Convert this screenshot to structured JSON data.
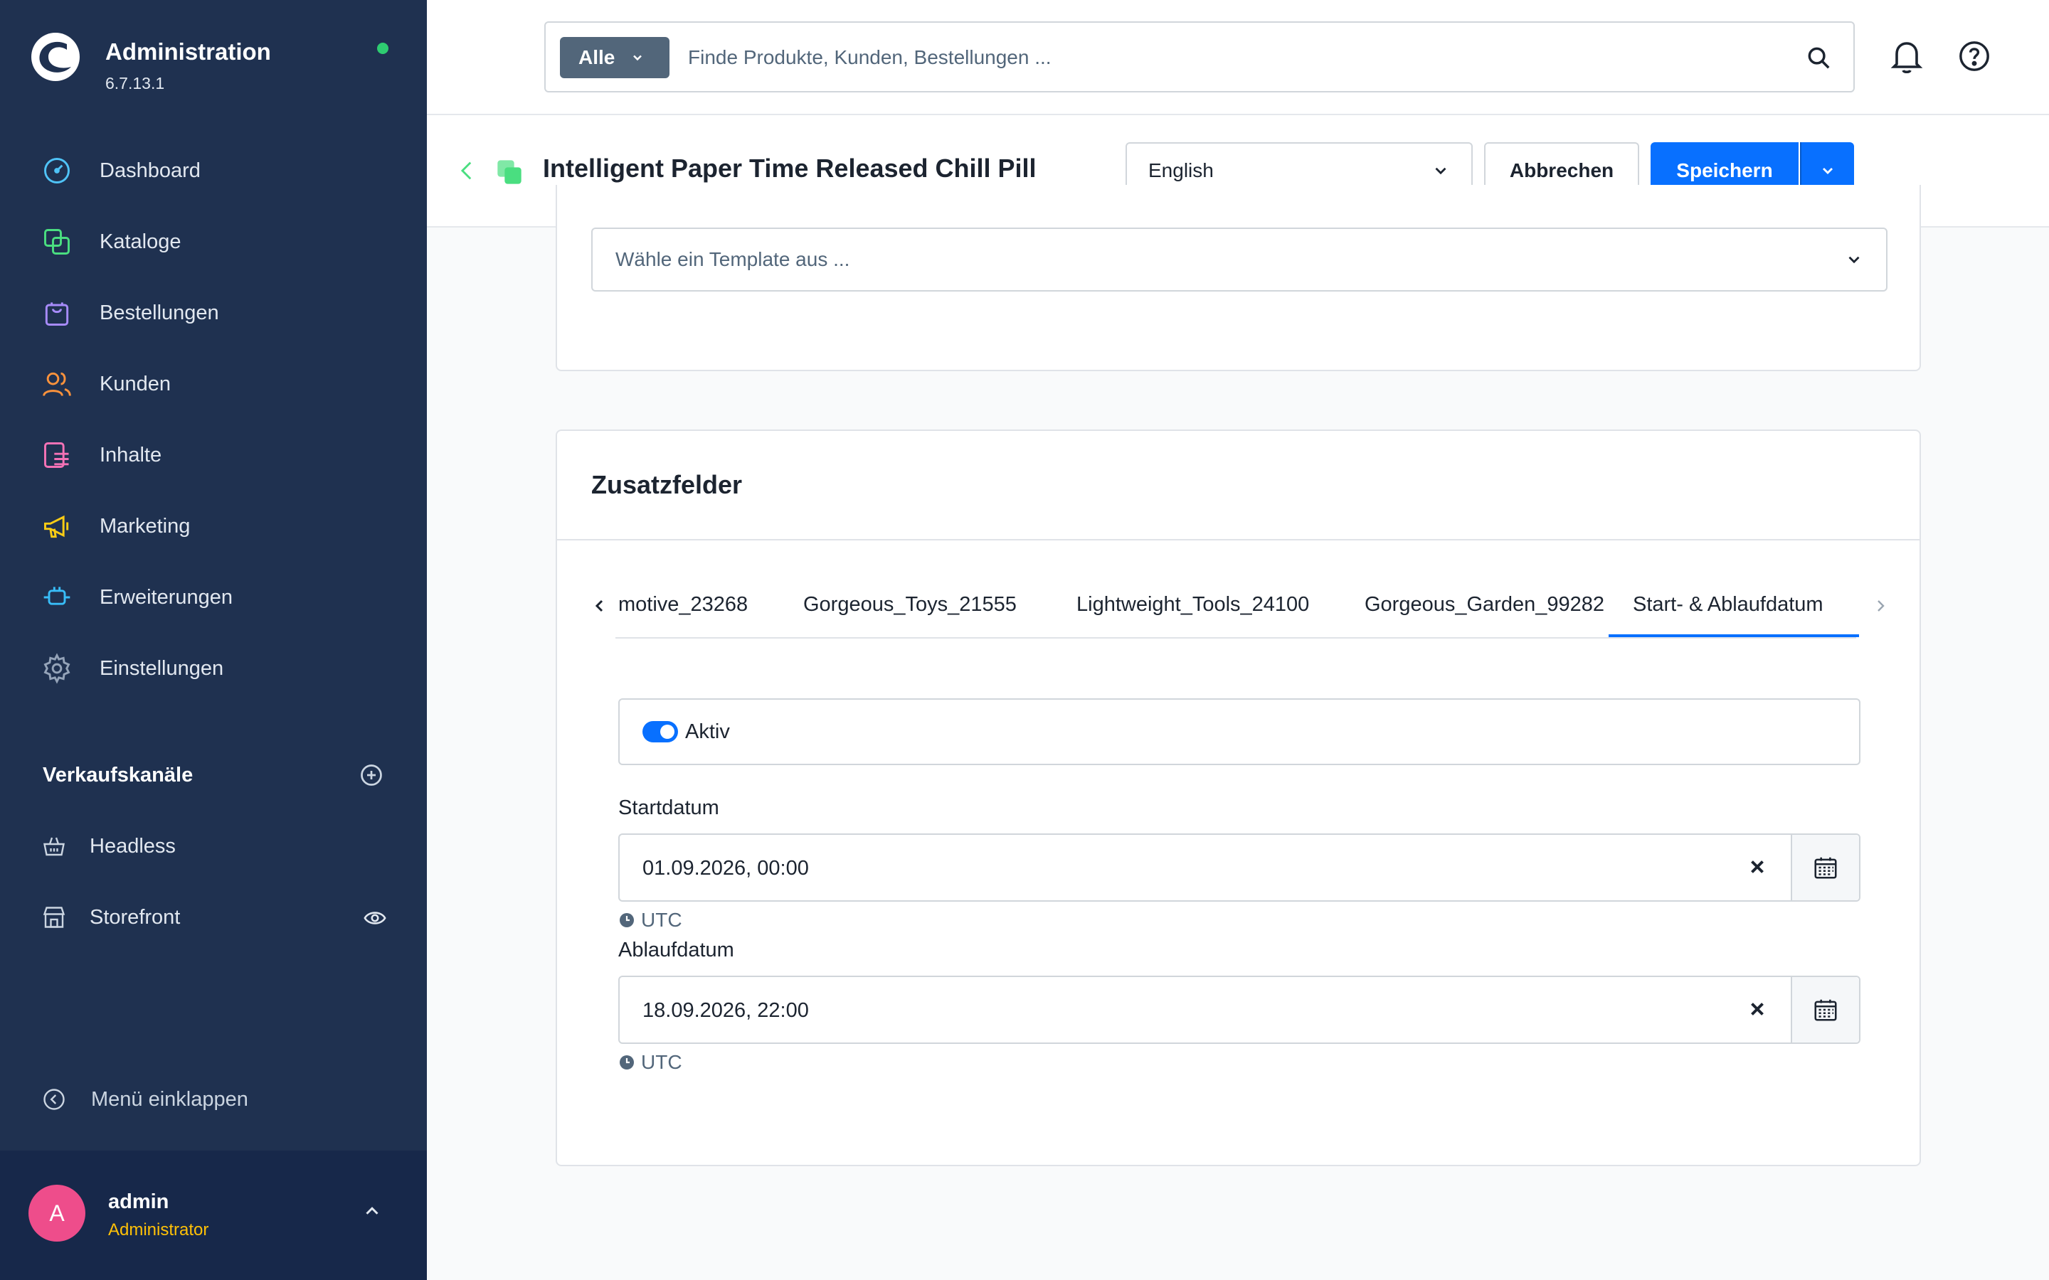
{
  "app": {
    "title": "Administration",
    "version": "6.7.13.1",
    "status_color": "#2ecc71"
  },
  "sidebar": {
    "items": [
      {
        "label": "Dashboard",
        "icon": "gauge-icon",
        "color": "#4fc3f7"
      },
      {
        "label": "Kataloge",
        "icon": "catalog-icon",
        "color": "#4ade80"
      },
      {
        "label": "Bestellungen",
        "icon": "shopping-bag-icon",
        "color": "#a78bfa"
      },
      {
        "label": "Kunden",
        "icon": "users-icon",
        "color": "#fb923c"
      },
      {
        "label": "Inhalte",
        "icon": "content-icon",
        "color": "#f472b6"
      },
      {
        "label": "Marketing",
        "icon": "megaphone-icon",
        "color": "#facc15"
      },
      {
        "label": "Erweiterungen",
        "icon": "plug-icon",
        "color": "#38bdf8"
      },
      {
        "label": "Einstellungen",
        "icon": "gear-icon",
        "color": "#94a3b8"
      }
    ],
    "channels_title": "Verkaufskanäle",
    "channels": [
      {
        "label": "Headless",
        "icon": "basket-icon"
      },
      {
        "label": "Storefront",
        "icon": "store-icon"
      }
    ],
    "collapse_label": "Menü einklappen",
    "user": {
      "initial": "A",
      "name": "admin",
      "role": "Administrator"
    }
  },
  "search": {
    "type_label": "Alle",
    "placeholder": "Finde Produkte, Kunden, Bestellungen ..."
  },
  "smartbar": {
    "title": "Intelligent Paper Time Released Chill Pill",
    "language": "English",
    "cancel_label": "Abbrechen",
    "save_label": "Speichern"
  },
  "template": {
    "placeholder": "Wähle ein Template aus ..."
  },
  "custom_fields": {
    "title": "Zusatzfelder",
    "tabs": [
      {
        "label": "motive_23268",
        "active": false
      },
      {
        "label": "Gorgeous_Toys_21555",
        "active": false
      },
      {
        "label": "Lightweight_Tools_24100",
        "active": false
      },
      {
        "label": "Gorgeous_Garden_99282",
        "active": false
      },
      {
        "label": "Start- & Ablaufdatum",
        "active": true
      }
    ],
    "active_label": "Aktiv",
    "active_on": true,
    "start_label": "Startdatum",
    "start_value": "01.09.2026, 00:00",
    "start_tz": "UTC",
    "end_label": "Ablaufdatum",
    "end_value": "18.09.2026, 22:00",
    "end_tz": "UTC"
  },
  "colors": {
    "sidebar_bg": "#1f3150",
    "primary": "#0870ff",
    "avatar": "#ee4d8b",
    "role": "#ffc107"
  }
}
